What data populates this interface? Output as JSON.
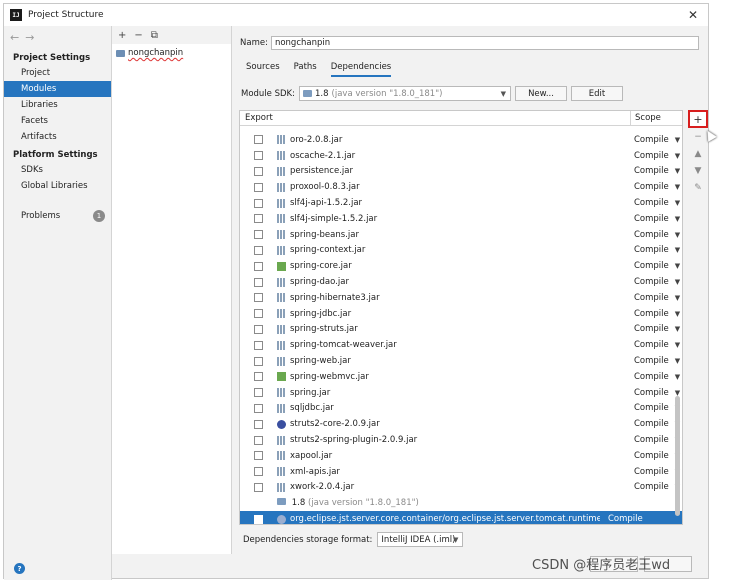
{
  "window": {
    "title": "Project Structure",
    "app_icon": "IJ",
    "close_glyph": "✕"
  },
  "sidebar": {
    "back_glyph": "←",
    "forward_glyph": "→",
    "project_settings_header": "Project Settings",
    "project_items": [
      "Project",
      "Modules",
      "Libraries",
      "Facets",
      "Artifacts"
    ],
    "selected_item": "Modules",
    "platform_settings_header": "Platform Settings",
    "platform_items": [
      "SDKs",
      "Global Libraries"
    ],
    "problems_label": "Problems",
    "problems_count": "1",
    "help_glyph": "?"
  },
  "modules": {
    "add_glyph": "+",
    "remove_glyph": "−",
    "copy_glyph": "⧉",
    "items": [
      "nongchanpin"
    ]
  },
  "main": {
    "name_label": "Name:",
    "name_value": "nongchanpin",
    "tabs": [
      "Sources",
      "Paths",
      "Dependencies"
    ],
    "active_tab": "Dependencies",
    "sdk_label": "Module SDK:",
    "sdk_version": "1.8",
    "sdk_detail": "(java version \"1.8.0_181\")",
    "new_button": "New...",
    "edit_button": "Edit",
    "table": {
      "col_export": "Export",
      "col_scope": "Scope",
      "partial_row": "oro-2.0.8.jar",
      "rows": [
        {
          "name": "oro-2.0.8.jar",
          "scope": "Compile",
          "icon": "jar"
        },
        {
          "name": "oscache-2.1.jar",
          "scope": "Compile",
          "icon": "jar"
        },
        {
          "name": "persistence.jar",
          "scope": "Compile",
          "icon": "jar"
        },
        {
          "name": "proxool-0.8.3.jar",
          "scope": "Compile",
          "icon": "jar"
        },
        {
          "name": "slf4j-api-1.5.2.jar",
          "scope": "Compile",
          "icon": "jar"
        },
        {
          "name": "slf4j-simple-1.5.2.jar",
          "scope": "Compile",
          "icon": "jar"
        },
        {
          "name": "spring-beans.jar",
          "scope": "Compile",
          "icon": "jar"
        },
        {
          "name": "spring-context.jar",
          "scope": "Compile",
          "icon": "jar"
        },
        {
          "name": "spring-core.jar",
          "scope": "Compile",
          "icon": "spring"
        },
        {
          "name": "spring-dao.jar",
          "scope": "Compile",
          "icon": "jar"
        },
        {
          "name": "spring-hibernate3.jar",
          "scope": "Compile",
          "icon": "jar"
        },
        {
          "name": "spring-jdbc.jar",
          "scope": "Compile",
          "icon": "jar"
        },
        {
          "name": "spring-struts.jar",
          "scope": "Compile",
          "icon": "jar"
        },
        {
          "name": "spring-tomcat-weaver.jar",
          "scope": "Compile",
          "icon": "jar"
        },
        {
          "name": "spring-web.jar",
          "scope": "Compile",
          "icon": "jar"
        },
        {
          "name": "spring-webmvc.jar",
          "scope": "Compile",
          "icon": "spring"
        },
        {
          "name": "spring.jar",
          "scope": "Compile",
          "icon": "jar"
        },
        {
          "name": "sqljdbc.jar",
          "scope": "Compile",
          "icon": "jar"
        },
        {
          "name": "struts2-core-2.0.9.jar",
          "scope": "Compile",
          "icon": "struts"
        },
        {
          "name": "struts2-spring-plugin-2.0.9.jar",
          "scope": "Compile",
          "icon": "jar"
        },
        {
          "name": "xapool.jar",
          "scope": "Compile",
          "icon": "jar"
        },
        {
          "name": "xml-apis.jar",
          "scope": "Compile",
          "icon": "jar"
        },
        {
          "name": "xwork-2.0.4.jar",
          "scope": "Compile",
          "icon": "jar"
        }
      ],
      "sdk_row": {
        "version": "1.8",
        "detail": "(java version \"1.8.0_181\")"
      },
      "selected_row": {
        "name": "org.eclipse.jst.server.core.container/org.eclipse.jst.server.tomcat.runtimeTarget/Apach",
        "scope": "Compile"
      }
    },
    "side_tools": {
      "add": "+",
      "remove": "−",
      "up": "▲",
      "down": "▼",
      "edit": "✎"
    },
    "storage_label": "Dependencies storage format:",
    "storage_value": "IntelliJ IDEA (.iml)",
    "watermark": "CSDN @程序员老王wd"
  }
}
